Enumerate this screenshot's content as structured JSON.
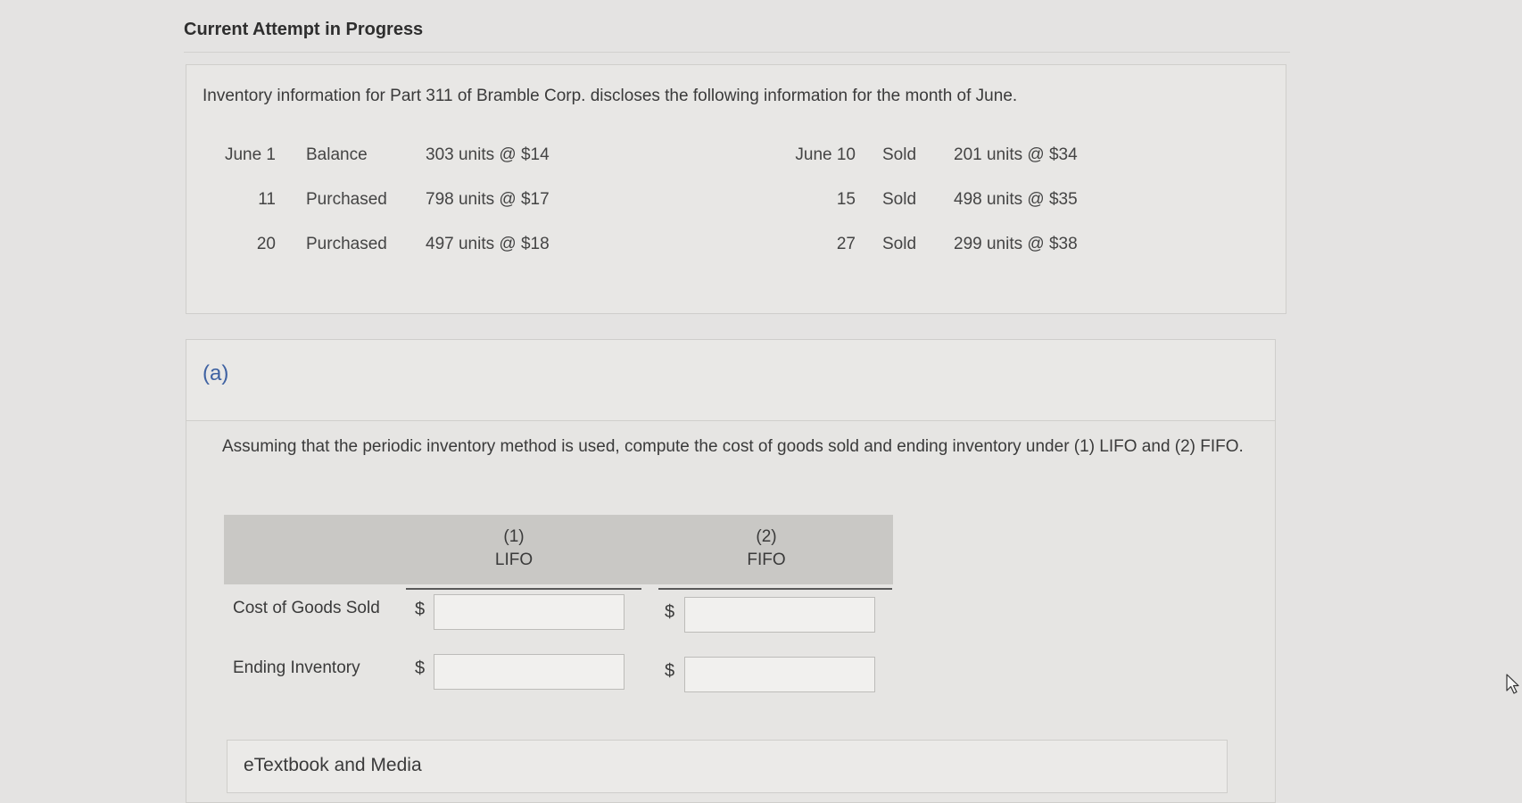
{
  "header": {
    "attempt_title": "Current Attempt in Progress"
  },
  "inventory": {
    "intro": "Inventory information for Part 311 of Bramble Corp. discloses the following information for the month of June.",
    "rows": [
      {
        "date1": "June  1",
        "action1": "Balance",
        "units1": "303 units @ $14",
        "date2": "June 10",
        "action2": "Sold",
        "units2": "201 units @ $34"
      },
      {
        "date1": "11",
        "action1": "Purchased",
        "units1": "798 units @ $17",
        "date2": "15",
        "action2": "Sold",
        "units2": "498 units @ $35"
      },
      {
        "date1": "20",
        "action1": "Purchased",
        "units1": "497 units @ $18",
        "date2": "27",
        "action2": "Sold",
        "units2": "299 units @ $38"
      }
    ]
  },
  "part_a": {
    "label": "(a)",
    "question": "Assuming that the periodic inventory method is used, compute the cost of goods sold and ending inventory under (1) LIFO and (2) FIFO.",
    "columns": [
      {
        "number": "(1)",
        "name": "LIFO"
      },
      {
        "number": "(2)",
        "name": "FIFO"
      }
    ],
    "rows": [
      {
        "label": "Cost of Goods Sold",
        "currency": "$",
        "lifo_value": "",
        "fifo_value": ""
      },
      {
        "label": "Ending Inventory",
        "currency": "$",
        "lifo_value": "",
        "fifo_value": ""
      }
    ]
  },
  "etextbook": {
    "label": "eTextbook and Media"
  },
  "icons": {
    "cursor": "mouse-pointer-icon"
  }
}
